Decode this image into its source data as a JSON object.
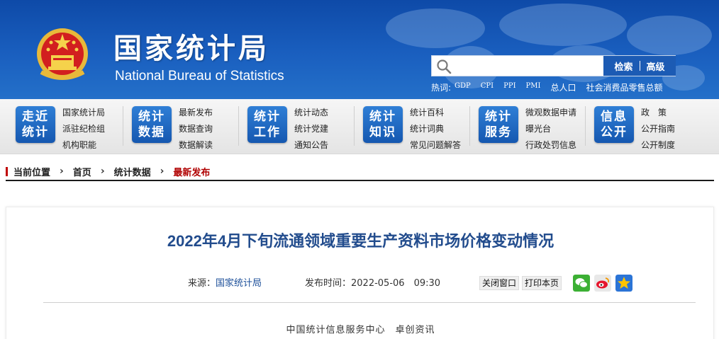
{
  "header": {
    "title_cn": "国家统计局",
    "title_en": "National Bureau of Statistics",
    "search": {
      "placeholder": "",
      "search_label": "检索",
      "advanced_label": "高级"
    },
    "hot": {
      "label": "热词:",
      "keywords": [
        "GDP",
        "CPI",
        "PPI",
        "PMI",
        "总人口",
        "社会消费品零售总额"
      ]
    },
    "colors": {
      "banner": "#1a5fbf",
      "accent": "#c00000",
      "title_blue": "#224c8d"
    }
  },
  "nav": [
    {
      "badge": [
        "走近",
        "统计"
      ],
      "links": [
        "国家统计局",
        "派驻纪检组",
        "机构职能"
      ]
    },
    {
      "badge": [
        "统计",
        "数据"
      ],
      "links": [
        "最新发布",
        "数据查询",
        "数据解读"
      ]
    },
    {
      "badge": [
        "统计",
        "工作"
      ],
      "links": [
        "统计动态",
        "统计党建",
        "通知公告"
      ]
    },
    {
      "badge": [
        "统计",
        "知识"
      ],
      "links": [
        "统计百科",
        "统计词典",
        "常见问题解答"
      ]
    },
    {
      "badge": [
        "统计",
        "服务"
      ],
      "links": [
        "微观数据申请",
        "曝光台",
        "行政处罚信息"
      ]
    },
    {
      "badge": [
        "信息",
        "公开"
      ],
      "links": [
        "政　策",
        "公开指南",
        "公开制度"
      ]
    }
  ],
  "breadcrumb": {
    "label": "当前位置",
    "items": [
      "首页",
      "统计数据",
      "最新发布"
    ]
  },
  "article": {
    "title": "2022年4月下旬流通领域重要生产资料市场价格变动情况",
    "source_label": "来源：",
    "source": "国家统计局",
    "date_label": "发布时间：",
    "date": "2022-05-06　09:30",
    "close_label": "关闭窗口",
    "print_label": "打印本页",
    "share_icons": [
      "wechat-icon",
      "weibo-icon",
      "qzone-icon"
    ],
    "byline": "中国统计信息服务中心　卓创资讯"
  }
}
